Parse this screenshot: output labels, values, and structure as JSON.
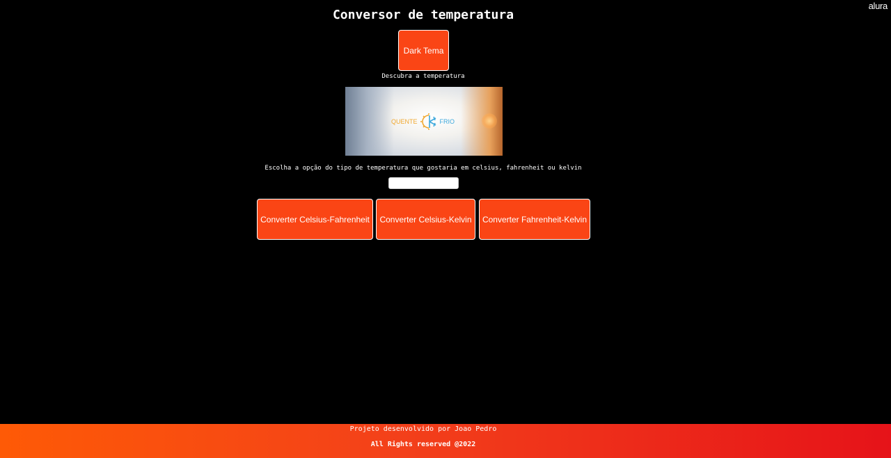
{
  "brand": "alura",
  "header": {
    "title": "Conversor de temperatura",
    "theme_button": "Dark Tema",
    "subtitle": "Descubra a temperatura"
  },
  "banner": {
    "hot_label": "QUENTE",
    "cold_label": "FRIO"
  },
  "form": {
    "prompt": "Escolha a opção do tipo de temperatura que gostaria em celsius, fahrenheit ou kelvin",
    "input_value": ""
  },
  "actions": [
    {
      "label": "Converter Celsius-Fahrenheit"
    },
    {
      "label": "Converter Celsius-Kelvin"
    },
    {
      "label": "Converter Fahrenheit-Kelvin"
    }
  ],
  "footer": {
    "credit": "Projeto desenvolvido por Joao Pedro",
    "rights": "All Rights reserved @2022"
  },
  "colors": {
    "accent": "#fa4515",
    "background": "#000000",
    "footer_start": "#fe5a06",
    "footer_end": "#e61319"
  }
}
